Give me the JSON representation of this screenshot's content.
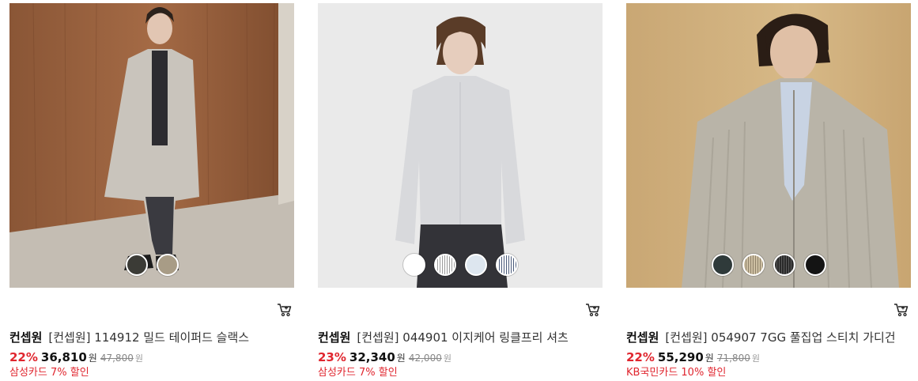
{
  "products": [
    {
      "brand": "컨셉원",
      "name": "[컨셉원] 114912 밀드 테이퍼드 슬랙스",
      "discount": "22%",
      "sale_price": "36,810",
      "currency": "원",
      "original_price": "47,800",
      "original_currency": "원",
      "card_promo": "삼성카드 7% 할인",
      "image_desc": "model in grey overcoat against wood wall",
      "swatches": [
        "#3b3b36",
        "#a89c86"
      ],
      "selected_swatch": 0
    },
    {
      "brand": "컨셉원",
      "name": "[컨셉원] 044901 이지케어 링클프리 셔츠",
      "discount": "23%",
      "sale_price": "32,340",
      "currency": "원",
      "original_price": "42,000",
      "original_currency": "원",
      "card_promo": "삼성카드 7% 할인",
      "image_desc": "model in light grey shirt on light background",
      "swatches": [
        "#ffffff",
        "striped-grey",
        "#dde6ef",
        "striped-navy"
      ],
      "selected_swatch": 0
    },
    {
      "brand": "컨셉원",
      "name": "[컨셉원] 054907 7GG 풀집업 스티치 가디건",
      "discount": "22%",
      "sale_price": "55,290",
      "currency": "원",
      "original_price": "71,800",
      "original_currency": "원",
      "card_promo": "KB국민카드 10% 할인",
      "image_desc": "model in knit zip-up cardigan on beige background",
      "swatches": [
        "#2f3a3a",
        "striped-beige",
        "striped-black",
        "#141414"
      ],
      "selected_swatch": 0
    }
  ],
  "colors": {
    "discount_red": "#e0262f",
    "text_dark": "#111111",
    "text_muted": "#888888"
  },
  "icons": {
    "cart": "cart-icon"
  }
}
